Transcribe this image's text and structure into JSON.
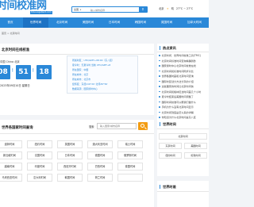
{
  "header": {
    "logo": "时间校准网",
    "logo_sub": "time.sogaitech.com",
    "search_select": "全国",
    "search_placeholder": "输入城市名称",
    "search_icon": "search-icon",
    "weather": [
      "北京",
      "晴",
      "27°C ~ 27°C"
    ]
  },
  "nav": [
    {
      "label": "首页",
      "active": false
    },
    {
      "label": "世界时间",
      "active": true
    },
    {
      "label": "北京时间",
      "active": false
    },
    {
      "label": "美国时间",
      "active": false
    },
    {
      "label": "日本时间",
      "active": false
    },
    {
      "label": "韩国时间",
      "active": false
    },
    {
      "label": "英国时间",
      "active": false
    },
    {
      "label": "加拿大时间",
      "active": false
    }
  ],
  "breadcrumb": [
    "首页",
    "北京时间"
  ],
  "beijing": {
    "title": "北京时间在线校准",
    "location": "中国 China 北京",
    "hours": "08",
    "minutes": "51",
    "seconds": "18",
    "date_line": "2023年09月10日 星期日",
    "info": [
      "所属时区：UTC/GMT+08:00（东八区）",
      "夏令时：无夏令时 当前 UTC/GMT+8",
      "所在国家：中国",
      "所在城市：北京",
      "所在城市：北京市",
      "经纬度：东经116°20′ 北纬39°56′",
      "数据来源：国家授时中心"
    ]
  },
  "world": {
    "title": "世界各国家时间查询",
    "search_label": "搜索",
    "search_placeholder": "输入国家/城市名称",
    "cities": [
      [
        "迪拜时间",
        "纽约时间",
        "英国时间",
        "澳大利亚时间",
        "瑞士时间"
      ],
      [
        "新加坡时间",
        "法国时间",
        "日本时间",
        "德国时间",
        "俄罗斯时间"
      ],
      [
        "越南时间",
        "印度时间",
        "西班牙时间",
        "巴西时间",
        "泰国时间"
      ],
      [
        "马来西亚时间",
        "意大利时间",
        "韩国时间",
        "荷兰时间",
        ""
      ]
    ]
  },
  "hot": {
    "title": "热点资讯",
    "items": [
      "北京时间：世界时间校准工具(TMC)",
      "北京时间标准时间查询精确到秒",
      "国家授时中心北京时间校准在线",
      "北京时间和标准时间同步对比",
      "世界各国时差和北京时间查询",
      "国际时区划分方法分享的介绍",
      "这些国家的时间比北京时间快",
      "北京时间和格林尼治时间差几个小时",
      "夏令时结束后美国时间调整了",
      "国际时间校准可以帮我们做什么",
      "手机为什么没有北京时间显示",
      "北京时间到底是怎么来的详解",
      "你知道为什么北京时间是东八区",
      "世界时间和北京时间是怎样换算的"
    ]
  },
  "side1": {
    "title": "世界时间",
    "boxes": [
      "北京时间",
      "东京时间",
      "美国时间",
      "纽约时间",
      "伦敦时间"
    ]
  },
  "side2": {
    "title": "世界时差"
  }
}
